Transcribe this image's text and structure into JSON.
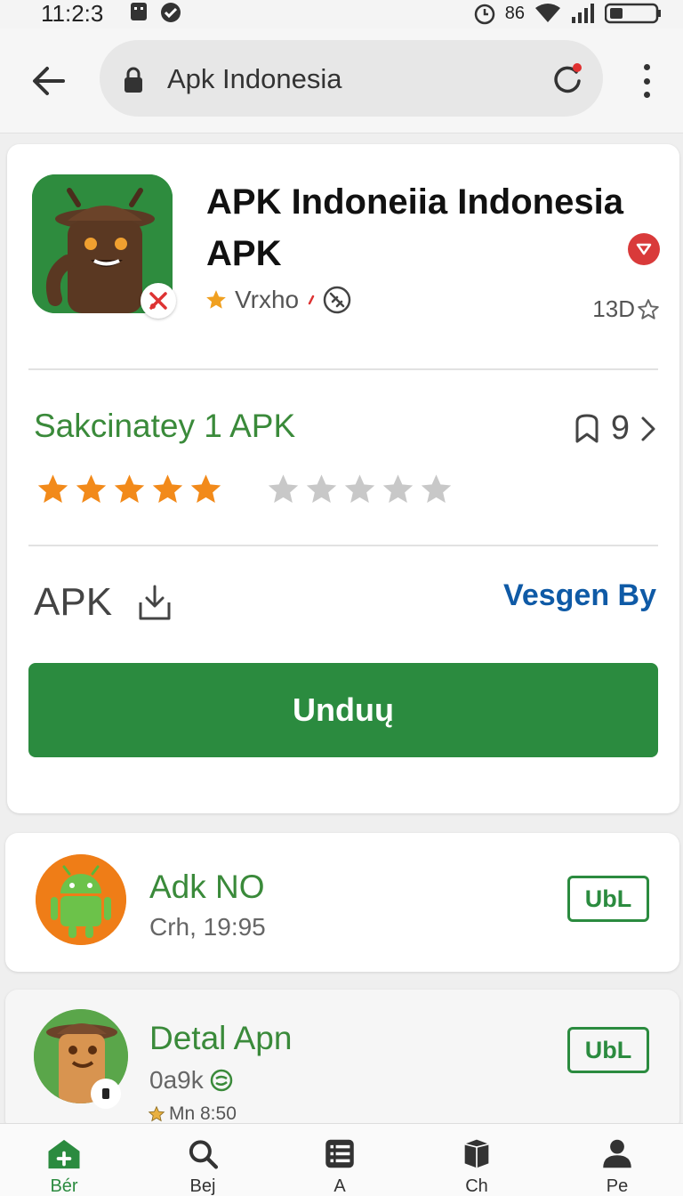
{
  "status_bar": {
    "time": "11:2:3",
    "network_label": "86"
  },
  "browser": {
    "url_text": "Apk Indonesia"
  },
  "app": {
    "title": "APK Indoneiia Indonesia APK",
    "developer": "Vrxho",
    "size": "13D",
    "section_title": "Sakcinatey 1 APK",
    "rating_count": "9",
    "rating": {
      "filled": 5,
      "empty": 5
    },
    "apk_label": "APK",
    "version_link": "Vesgen By",
    "download_label": "Unduų",
    "icon_bg_color": "#2e8c3e"
  },
  "related": [
    {
      "title": "Adk NO",
      "subtitle": "Crh,  19:95",
      "action_label": "UbL",
      "icon": "android-robot-icon",
      "icon_bg": "#ef7d17"
    },
    {
      "title": "Detal Apn",
      "subtitle": "0a9k",
      "meta": "Mn 8:50",
      "action_label": "UbL",
      "icon": "bear-robot-icon",
      "icon_bg": "#5aa64a"
    }
  ],
  "bottom_nav": [
    {
      "label": "Bér",
      "icon": "home-add-icon",
      "active": true
    },
    {
      "label": "Bej",
      "icon": "search-icon"
    },
    {
      "label": "A",
      "icon": "list-icon"
    },
    {
      "label": "Ch",
      "icon": "box-icon"
    },
    {
      "label": "Pe",
      "icon": "profile-icon"
    }
  ],
  "colors": {
    "accent": "#2b8b3f",
    "link": "#0f5aa6",
    "star_filled": "#f28a1a",
    "star_empty": "#c8c8c8"
  }
}
